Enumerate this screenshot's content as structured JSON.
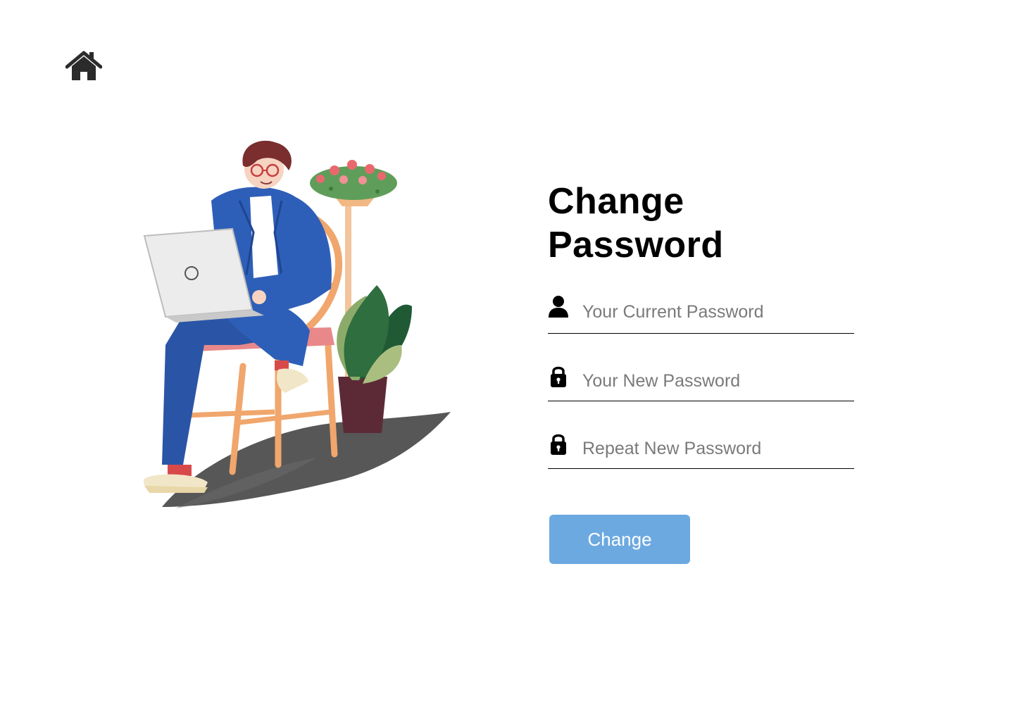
{
  "nav": {
    "home_icon": "home-icon"
  },
  "form": {
    "title": "Change Password",
    "fields": [
      {
        "icon": "user-icon",
        "placeholder": "Your Current Password",
        "value": ""
      },
      {
        "icon": "lock-icon",
        "placeholder": "Your New Password",
        "value": ""
      },
      {
        "icon": "lock-icon",
        "placeholder": "Repeat New Password",
        "value": ""
      }
    ],
    "submit_label": "Change"
  },
  "colors": {
    "button_bg": "#6ca9e0",
    "button_text": "#ffffff",
    "title": "#000000",
    "placeholder": "#7a7a7a",
    "underline": "#000000"
  },
  "illustration": {
    "subject": "person-with-laptop-on-chair-illustration"
  }
}
